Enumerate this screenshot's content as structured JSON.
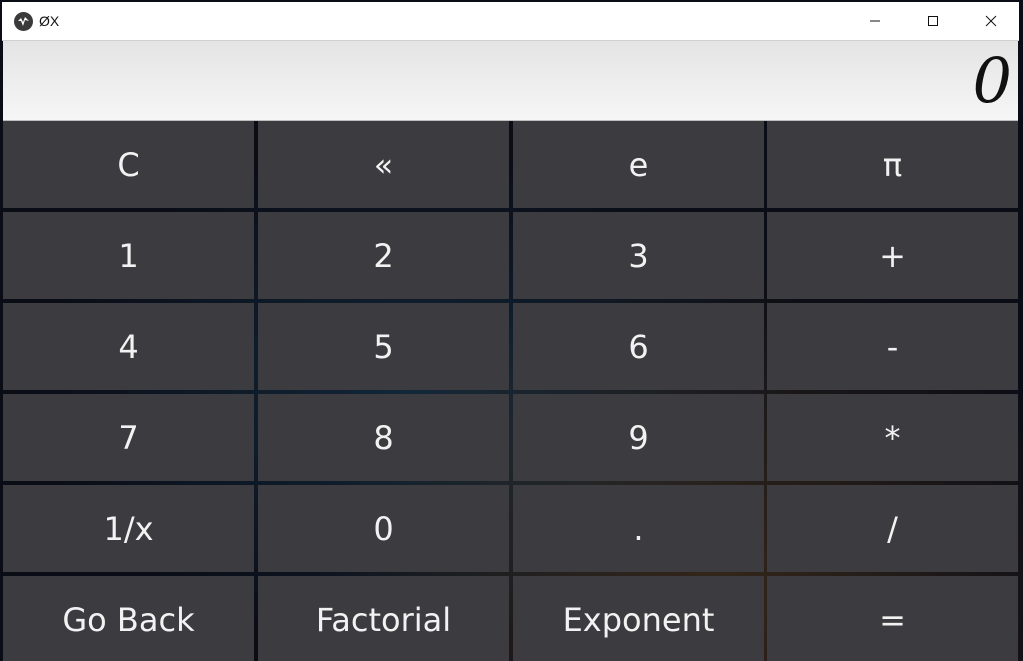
{
  "window": {
    "title": "ØX"
  },
  "display": {
    "value": "0"
  },
  "keypad": {
    "rows": [
      [
        "C",
        "«",
        "e",
        "π"
      ],
      [
        "1",
        "2",
        "3",
        "+"
      ],
      [
        "4",
        "5",
        "6",
        "-"
      ],
      [
        "7",
        "8",
        "9",
        "*"
      ],
      [
        "1/x",
        "0",
        ".",
        "/"
      ],
      [
        "Go Back",
        "Factorial",
        "Exponent",
        "="
      ]
    ]
  },
  "colors": {
    "key_bg": "#3c3b3f",
    "key_text": "#f2f2f2",
    "display_bg": "#f0f0f0",
    "titlebar_bg": "#ffffff"
  }
}
